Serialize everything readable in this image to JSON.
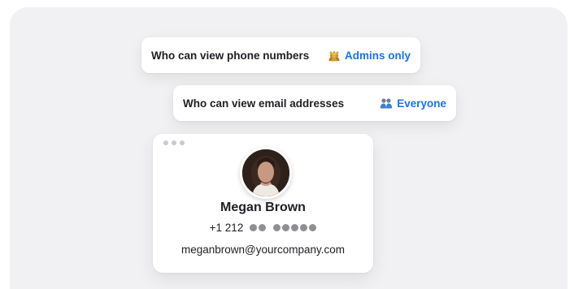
{
  "privacy_settings": [
    {
      "label": "Who can view phone numbers",
      "value": "Admins only",
      "icon": "crown-people-icon"
    },
    {
      "label": "Who can view email addresses",
      "value": "Everyone",
      "icon": "people-icon"
    }
  ],
  "contact_card": {
    "name": "Megan Brown",
    "phone_prefix": "+1 212",
    "phone_masked_groups": [
      2,
      5
    ],
    "email": "meganbrown@yourcompany.com"
  },
  "colors": {
    "accent": "#1a73e8",
    "background": "#f1f1f3",
    "text": "#1f1f24",
    "mask_dot": "#8e8e94"
  }
}
